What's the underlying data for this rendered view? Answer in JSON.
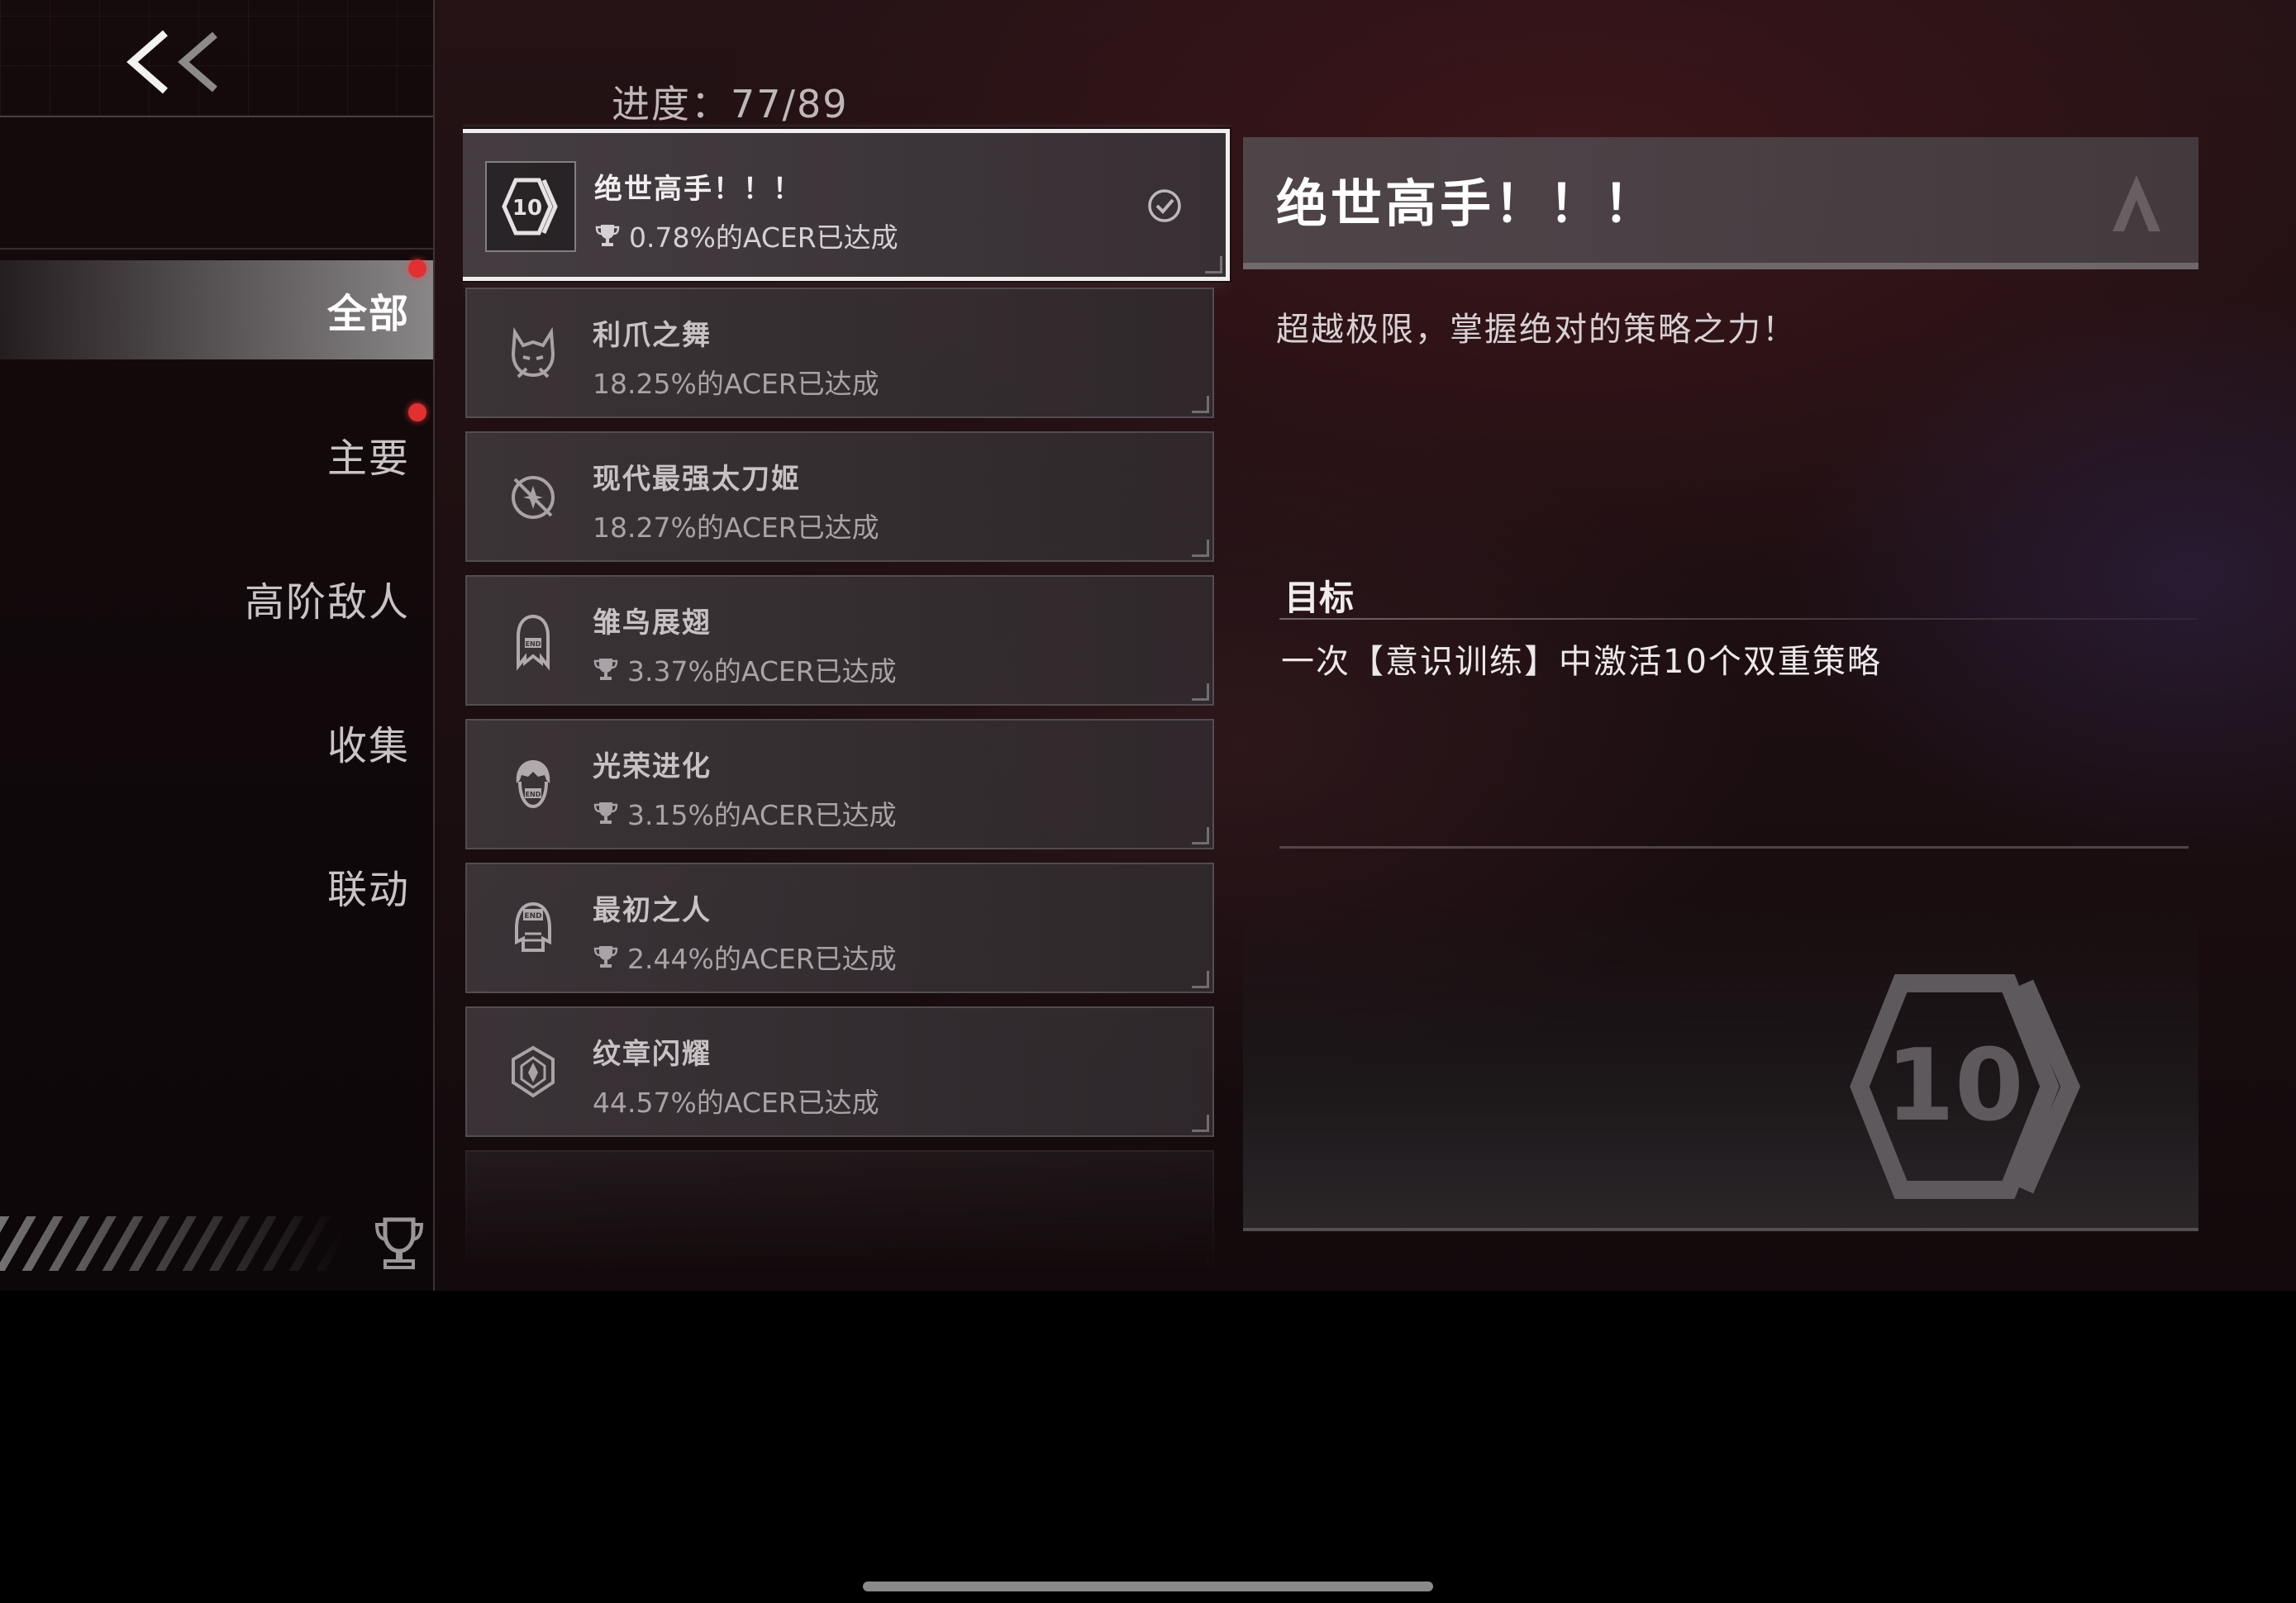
{
  "progress": "进度：77/89",
  "sidebar": {
    "back_icon": "double-chevron-left-icon",
    "items": [
      {
        "label": "全部",
        "active": true,
        "badge": true
      },
      {
        "label": "主要",
        "active": false,
        "badge": true
      },
      {
        "label": "高阶敌人",
        "active": false,
        "badge": false
      },
      {
        "label": "收集",
        "active": false,
        "badge": false
      },
      {
        "label": "联动",
        "active": false,
        "badge": false
      }
    ],
    "footer_icon": "trophy-icon"
  },
  "achievements": [
    {
      "title": "绝世高手！！！",
      "rate": "0.78%的ACER已达成",
      "trophy": true,
      "icon": "hexagon-10-icon",
      "selected": true,
      "completed": true
    },
    {
      "title": "利爪之舞",
      "rate": "18.25%的ACER已达成",
      "trophy": false,
      "icon": "cat-claw-icon",
      "selected": false
    },
    {
      "title": "现代最强太刀姬",
      "rate": "18.27%的ACER已达成",
      "trophy": false,
      "icon": "crossed-sword-icon",
      "selected": false
    },
    {
      "title": "雏鸟展翅",
      "rate": "3.37%的ACER已达成",
      "trophy": true,
      "icon": "girl-end-mask-icon",
      "selected": false
    },
    {
      "title": "光荣进化",
      "rate": "3.15%的ACER已达成",
      "trophy": true,
      "icon": "boy-end-mask-icon",
      "selected": false
    },
    {
      "title": "最初之人",
      "rate": "2.44%的ACER已达成",
      "trophy": true,
      "icon": "end-mask-icon",
      "selected": false
    },
    {
      "title": "纹章闪耀",
      "rate": "44.57%的ACER已达成",
      "trophy": false,
      "icon": "crest-icon",
      "selected": false
    }
  ],
  "detail": {
    "title": "绝世高手！！！",
    "description": "超越极限，掌握绝对的策略之力！",
    "goal_label": "目标",
    "goal_text": "一次【意识训练】中激活10个双重策略",
    "emblem": "hexagon-10-icon"
  },
  "colors": {
    "badge": "#e23030",
    "selected_border": "#f1eef0",
    "bg": "#1e0f12"
  }
}
